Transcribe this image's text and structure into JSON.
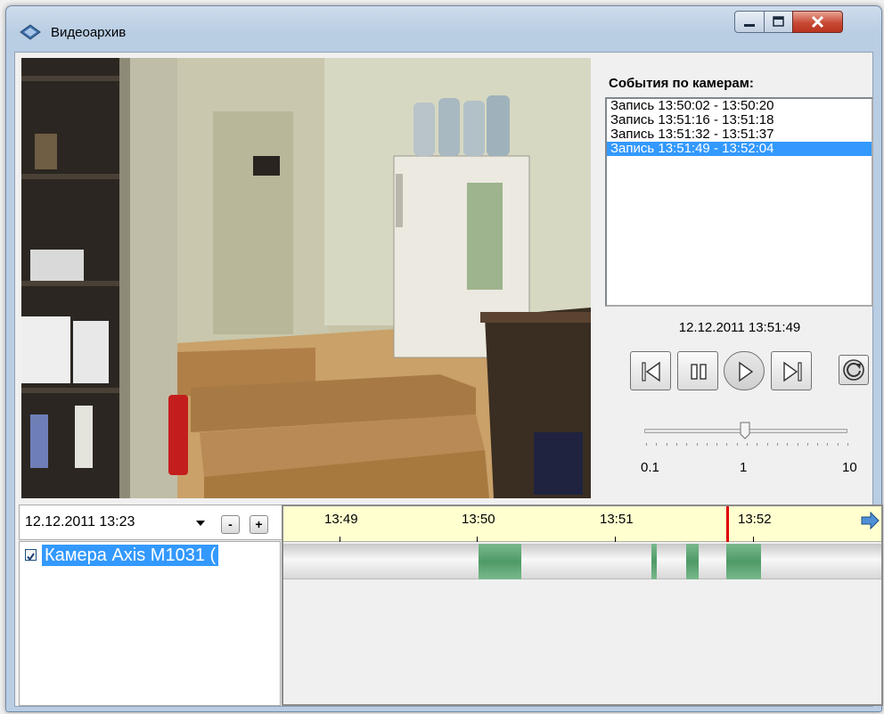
{
  "window": {
    "title": "Видеоархив"
  },
  "events": {
    "title": "События по камерам:",
    "items": [
      {
        "label": "Запись 13:50:02 - 13:50:20",
        "selected": false
      },
      {
        "label": "Запись 13:51:16 - 13:51:18",
        "selected": false
      },
      {
        "label": "Запись 13:51:32 - 13:51:37",
        "selected": false
      },
      {
        "label": "Запись 13:51:49 - 13:52:04",
        "selected": true
      }
    ]
  },
  "player": {
    "current_time": "12.12.2011 13:51:49",
    "speed": {
      "min_label": "0.1",
      "mid_label": "1",
      "max_label": "10",
      "value": 1
    }
  },
  "archive": {
    "datetime": "12.12.2011 13:23",
    "zoom_out_label": "-",
    "zoom_in_label": "+",
    "camera_label": "Камера Axis M1031 (",
    "camera_checked": true
  },
  "timeline": {
    "labels": [
      "13:49",
      "13:50",
      "13:51",
      "13:52"
    ],
    "cursor_time": "13:51:49",
    "record_color": "#4e9a66",
    "cursor_color": "#e00000"
  },
  "colors": {
    "selection": "#3399ff",
    "ruler_bg": "#ffffd0"
  }
}
